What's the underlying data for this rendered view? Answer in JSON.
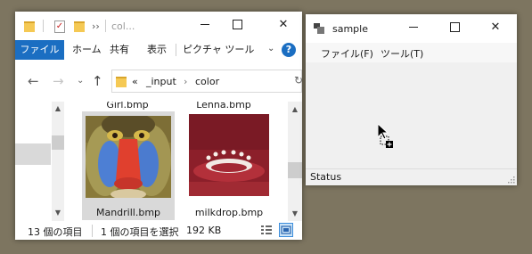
{
  "explorer": {
    "title": "col...",
    "title_chevrons": "››",
    "ribbon": {
      "file": "ファイル",
      "tabs": [
        "ホーム",
        "共有",
        "表示",
        "ピクチャ ツール"
      ],
      "help": "?"
    },
    "address": {
      "prefix": "«",
      "crumbs": [
        "_input",
        "color"
      ],
      "separator": "›"
    },
    "files": [
      {
        "name": "Girl.bmp",
        "partial": true
      },
      {
        "name": "Lenna.bmp",
        "partial": true
      },
      {
        "name": "Mandrill.bmp",
        "selected": true
      },
      {
        "name": "milkdrop.bmp"
      }
    ],
    "status": {
      "count": "13 個の項目",
      "selected": "1 個の項目を選択",
      "size": "192 KB"
    }
  },
  "sample": {
    "title": "sample",
    "menu": [
      "ファイル(F)",
      "ツール(T)"
    ],
    "status": "Status"
  },
  "colors": {
    "desktop": "#7d7560",
    "accent": "#1b6ec2",
    "selection": "#d9d9d9"
  }
}
